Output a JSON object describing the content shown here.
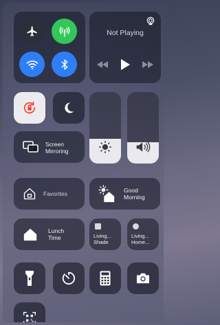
{
  "colors": {
    "airplane_bg": "#2b2f3c",
    "cellular_bg": "#33c759",
    "wifi_bg": "#2e7ff6",
    "bluetooth_bg": "#2e7ff6",
    "lock_tile_bg": "#ececf0",
    "lock_icon": "#ff3b30"
  },
  "now_playing": {
    "title": "Not Playing"
  },
  "screen_mirroring": {
    "line1": "Screen",
    "line2": "Mirroring"
  },
  "sliders": {
    "brightness_level": 0.35,
    "volume_level": 0.3
  },
  "home": {
    "favorites": "Favorites",
    "good_morning": {
      "line1": "Good",
      "line2": "Morning"
    },
    "lunch_time": {
      "line1": "Lunch",
      "line2": "Time"
    },
    "living_shade": {
      "line1": "Living...",
      "line2": "Shade"
    },
    "living_home": {
      "line1": "Living...",
      "line2": "Home..."
    }
  },
  "icons": [
    "airplane-icon",
    "cellular-icon",
    "wifi-icon",
    "bluetooth-icon",
    "airplay-icon",
    "rewind-icon",
    "play-icon",
    "fast-forward-icon",
    "rotation-lock-icon",
    "moon-icon",
    "screen-mirroring-icon",
    "brightness-icon",
    "volume-icon",
    "home-icon",
    "flashlight-icon",
    "timer-icon",
    "calculator-icon",
    "camera-icon",
    "qr-code-icon"
  ]
}
